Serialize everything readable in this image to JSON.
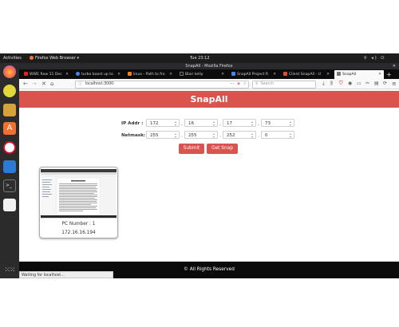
{
  "topbar": {
    "activities": "Activities",
    "app_menu": "Firefox Web Browser ▾",
    "clock": "Tue 23:12"
  },
  "window": {
    "title": "SnapAll - Mozilla Firefox"
  },
  "tabs": [
    {
      "label": "WWE Raw 11 Dec",
      "favicon_color": "#e62117"
    },
    {
      "label": "turbo boost up to",
      "favicon_color": "#4285f4"
    },
    {
      "label": "linux - Path to fro",
      "favicon_color": "#f48024"
    },
    {
      "label": "Blair kelly",
      "favicon_color": "#111111"
    },
    {
      "label": "SnapAll Project R",
      "favicon_color": "#4285f4"
    },
    {
      "label": "Client SnapAll - U",
      "favicon_color": "#e04e39"
    },
    {
      "label": "SnapAll",
      "favicon_color": "#7a7a7a"
    }
  ],
  "navbar": {
    "url": "localhost:3000",
    "search_placeholder": "Search",
    "more": "···"
  },
  "page": {
    "brand": "SnapAll",
    "ip_label": "IP Addr :",
    "netmask_label": "Netmask:",
    "ip": [
      "172",
      "16",
      "17",
      "73"
    ],
    "netmask": [
      "255",
      "255",
      "252",
      "0"
    ],
    "submit_label": "Submit",
    "getsnap_label": "Get Snap",
    "card": {
      "pc_number": "PC Number : 1",
      "ip": "172.16.16.194"
    },
    "footer": "© All Rights Reserved",
    "status": "Waiting for localhost..."
  },
  "colors": {
    "accent": "#d9534f",
    "footer": "#0a0a0a"
  }
}
